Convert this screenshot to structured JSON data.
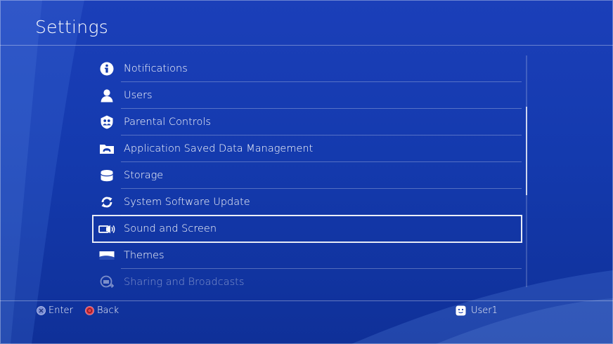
{
  "header": {
    "title": "Settings"
  },
  "menu": {
    "items": [
      {
        "label": "Notifications",
        "icon": "info-icon"
      },
      {
        "label": "Users",
        "icon": "user-icon"
      },
      {
        "label": "Parental Controls",
        "icon": "parental-controls-icon"
      },
      {
        "label": "Application Saved Data Management",
        "icon": "saved-data-icon"
      },
      {
        "label": "Storage",
        "icon": "storage-icon"
      },
      {
        "label": "System Software Update",
        "icon": "update-icon"
      },
      {
        "label": "Sound and Screen",
        "icon": "sound-screen-icon"
      },
      {
        "label": "Themes",
        "icon": "themes-icon"
      },
      {
        "label": "Sharing and Broadcasts",
        "icon": "sharing-icon"
      }
    ],
    "selected": "Sound and Screen"
  },
  "footer": {
    "enter_label": "Enter",
    "back_label": "Back",
    "user_name": "User1"
  },
  "colors": {
    "background": "#143aae",
    "cross_button": "#7d8fd6",
    "circle_button": "#e0404f"
  }
}
